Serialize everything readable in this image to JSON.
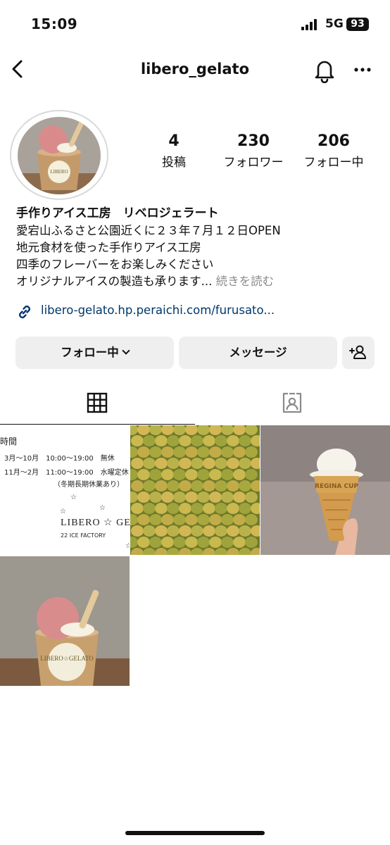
{
  "status_bar": {
    "time": "15:09",
    "network": "5G",
    "battery": "93"
  },
  "header": {
    "username": "libero_gelato"
  },
  "icons": {
    "back": "chevron-left-icon",
    "notifications": "bell-icon",
    "menu": "more-horizontal-icon",
    "link": "link-icon",
    "add_user": "add-user-icon",
    "grid_tab": "grid-icon",
    "tagged_tab": "tagged-person-icon"
  },
  "profile": {
    "stats": [
      {
        "value": "4",
        "label": "投稿"
      },
      {
        "value": "230",
        "label": "フォロワー"
      },
      {
        "value": "206",
        "label": "フォロー中"
      }
    ],
    "name": "手作りアイス工房　リベロジェラート",
    "bio_lines": [
      "愛宕山ふるさと公園近くに２３年７月１２日OPEN",
      "地元食材を使った手作りアイス工房",
      "四季のフレーバーをお楽しみください",
      "オリジナルアイスの製造も承ります..."
    ],
    "more_label": "続きを読む",
    "link": "libero-gelato.hp.peraichi.com/furusato..."
  },
  "actions": {
    "following": "フォロー中",
    "message": "メッセージ"
  },
  "posts": {
    "notice": {
      "title": "時間",
      "line1": "3月〜10月　10:00〜19:00　無休",
      "line2": "11月〜2月　11:00〜19:00　水曜定休",
      "line3": "（冬期長期休業あり）",
      "logo": "LIBERO ☆ GELA",
      "sub": "22 ICE FACTORY"
    },
    "cone_label": "REGINA CUP",
    "cup_label": "LIBERO☆GELATO"
  },
  "colors": {
    "link": "#00376b",
    "button_bg": "#efefef",
    "muted": "#8a8a8a"
  }
}
